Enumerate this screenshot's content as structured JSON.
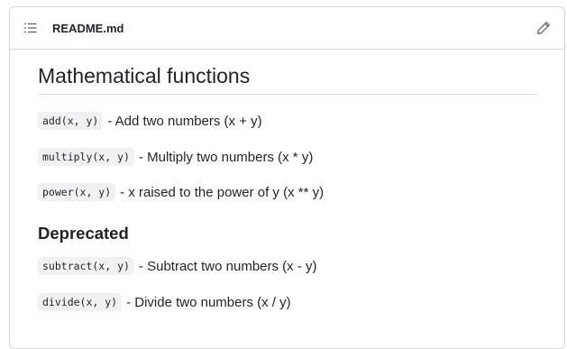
{
  "file": {
    "name": "README.md"
  },
  "readme": {
    "heading": "Mathematical functions",
    "items": [
      {
        "code": "add(x, y)",
        "desc": "- Add two numbers (x + y)"
      },
      {
        "code": "multiply(x, y)",
        "desc": "- Multiply two numbers (x * y)"
      },
      {
        "code": "power(x, y)",
        "desc": "- x raised to the power of y (x ** y)"
      }
    ],
    "deprecated_heading": "Deprecated",
    "deprecated_items": [
      {
        "code": "subtract(x, y)",
        "desc": "- Subtract two numbers (x - y)"
      },
      {
        "code": "divide(x, y)",
        "desc": "- Divide two numbers (x / y)"
      }
    ]
  },
  "icons": {
    "outline": "list-unordered-icon",
    "edit": "pencil-icon"
  }
}
